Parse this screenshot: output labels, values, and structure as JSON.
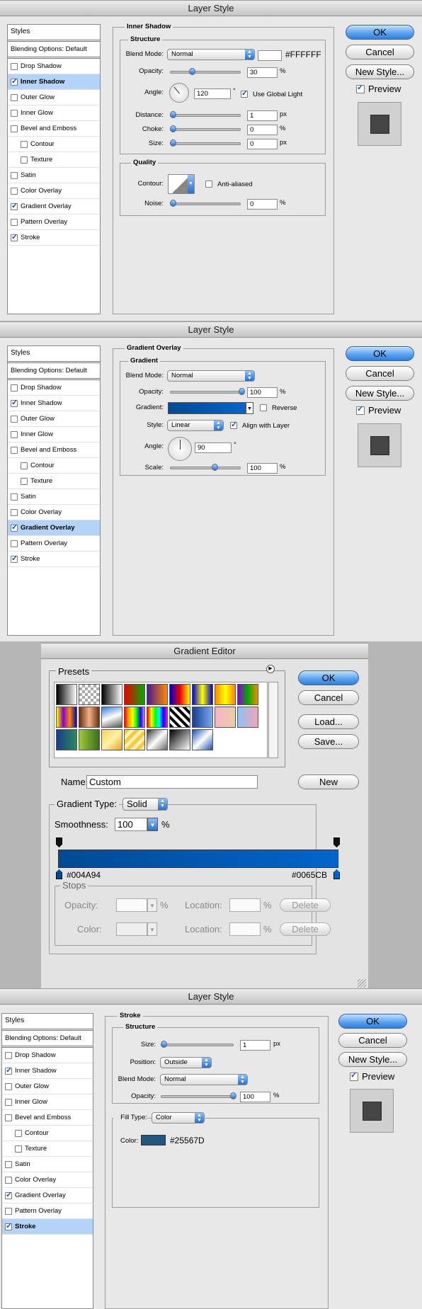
{
  "colors": {
    "gradient_start": "#004A94",
    "gradient_end": "#0065CB",
    "stroke_color": "#25567D",
    "selection": "#b5d2f8"
  },
  "style_list": [
    "Styles",
    "Blending Options: Default",
    "Drop Shadow",
    "Inner Shadow",
    "Outer Glow",
    "Inner Glow",
    "Bevel and Emboss",
    "Contour",
    "Texture",
    "Satin",
    "Color Overlay",
    "Gradient Overlay",
    "Pattern Overlay",
    "Stroke"
  ],
  "buttons": {
    "ok": "OK",
    "cancel": "Cancel",
    "new_style": "New Style...",
    "preview": "Preview",
    "load": "Load...",
    "save": "Save...",
    "new": "New",
    "delete": "Delete"
  },
  "units": {
    "pct": "%",
    "px": "px",
    "deg": "°"
  },
  "dialog1": {
    "title": "Layer Style",
    "section": "Inner Shadow",
    "structure": "Structure",
    "blend_mode_label": "Blend Mode:",
    "blend_mode": "Normal",
    "color_hex": "#FFFFFF",
    "opacity_label": "Opacity:",
    "opacity": "30",
    "angle_label": "Angle:",
    "angle": "120",
    "use_global_light": "Use Global Light",
    "distance_label": "Distance:",
    "distance": "1",
    "choke_label": "Choke:",
    "choke": "0",
    "size_label": "Size:",
    "size": "0",
    "quality": "Quality",
    "contour_label": "Contour:",
    "anti_aliased": "Anti-aliased",
    "noise_label": "Noise:",
    "noise": "0"
  },
  "dialog2": {
    "title": "Layer Style",
    "section": "Gradient Overlay",
    "group": "Gradient",
    "blend_mode_label": "Blend Mode:",
    "blend_mode": "Normal",
    "opacity_label": "Opacity:",
    "opacity": "100",
    "gradient_label": "Gradient:",
    "reverse": "Reverse",
    "style_label": "Style:",
    "style": "Linear",
    "align": "Align with Layer",
    "angle_label": "Angle:",
    "angle": "90",
    "scale_label": "Scale:",
    "scale": "100"
  },
  "editor": {
    "title": "Gradient Editor",
    "presets": "Presets",
    "name_label": "Name:",
    "name": "Custom",
    "gradient_type_label": "Gradient Type:",
    "gradient_type": "Solid",
    "smoothness_label": "Smoothness:",
    "smoothness": "100",
    "left_hex": "#004A94",
    "right_hex": "#0065CB",
    "stops": "Stops",
    "opacity_label": "Opacity:",
    "location_label": "Location:",
    "color_label": "Color:"
  },
  "dialog3": {
    "title": "Layer Style",
    "section": "Stroke",
    "structure": "Structure",
    "size_label": "Size:",
    "size": "1",
    "position_label": "Position:",
    "position": "Outside",
    "blend_mode_label": "Blend Mode:",
    "blend_mode": "Normal",
    "opacity_label": "Opacity:",
    "opacity": "100",
    "fill_type_label": "Fill Type:",
    "fill_type": "Color",
    "color_label": "Color:",
    "color_hex": "#25567D"
  }
}
